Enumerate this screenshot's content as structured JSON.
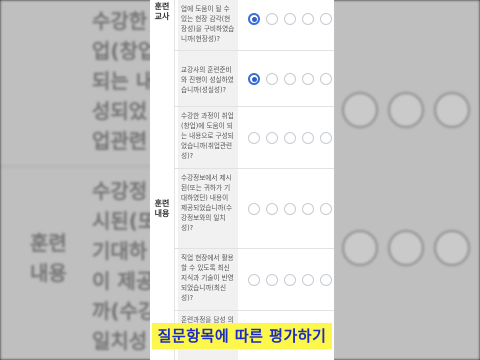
{
  "caption": "질문항목에 따른 평가하기",
  "colors": {
    "selected": "#2f5fca",
    "caption_bg": "#fcf74a",
    "caption_text": "#1c2cc2"
  },
  "categories": [
    {
      "lines": [
        "훈련",
        "교사"
      ]
    },
    {
      "lines": [
        "훈련",
        "내용"
      ]
    }
  ],
  "rows": [
    {
      "text": "업에 도움이 될 수 있는 현장 감각(현장성)을 구비하였습니까(현장성)?",
      "selected": 0
    },
    {
      "text": "교강사의 훈련준비와 진행이 성실하였습니까(성실성)?",
      "selected": 0
    },
    {
      "text": "수강한 과정이 취업(창업)에 도움이 되는 내용으로 구성되었습니까(취업관련성)?",
      "selected": null
    },
    {
      "text": "수강정보에서 제시된(또는 귀하가 기대하였던) 내용이 제공되었습니까(수강정보와의 일치성)?",
      "selected": null
    },
    {
      "text": "직업 현장에서 활용할 수 있도록 최신지식과 기술이 반영되었습니까(최신성)?",
      "selected": null
    },
    {
      "text": "훈련과정을 담성 의 배려가 적합하",
      "selected": null
    }
  ],
  "background": {
    "left_text_a": "수강한\n업(창업\n되는 내\n성되었\n업관련",
    "left_text_b": "수강정\n시된(또\n기대하\n이 제공\n까(수강\n일치성",
    "left_category": "훈련\n내용"
  }
}
